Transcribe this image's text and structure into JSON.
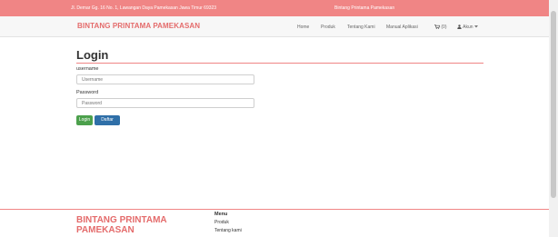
{
  "topbar": {
    "address": "Jl. Demar Gg. 16 No. 1, Lawangan Daya Pamekasan Jawa Timur 69323",
    "slogan": "Bintang Printama Pamekasan"
  },
  "navbar": {
    "brand": "BINTANG PRINTAMA PAMEKASAN",
    "items": [
      {
        "label": "Home"
      },
      {
        "label": "Produk"
      },
      {
        "label": "Tentang Kami"
      },
      {
        "label": "Manual Aplikasi"
      },
      {
        "label": "(0)",
        "icon": "cart-icon"
      },
      {
        "label": "Akun",
        "icon": "user-icon"
      }
    ]
  },
  "login": {
    "title": "Login",
    "username_label": "username",
    "username_placeholder": "Username",
    "password_label": "Password",
    "password_placeholder": "Password",
    "login_button": "Login",
    "register_button": "Daftar"
  },
  "footer": {
    "brand": "BINTANG PRINTAMA PAMEKASAN",
    "menu_title": "Menu",
    "links": [
      "Produk",
      "Tentang kami"
    ]
  },
  "colors": {
    "accent": "#f08585",
    "brand_text": "#e46b6b",
    "success": "#4ca04c",
    "primary": "#2f6fa8"
  }
}
